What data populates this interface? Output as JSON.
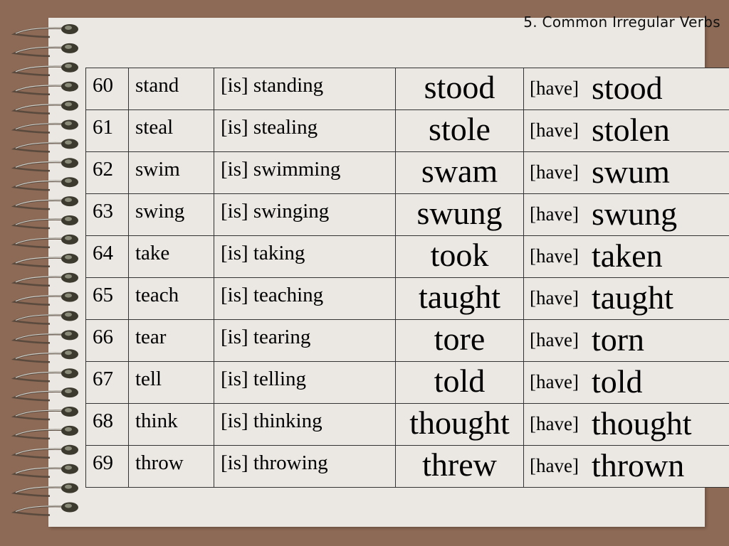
{
  "title": "5.  Common Irregular Verbs",
  "have_label": "[have]",
  "colors": {
    "background": "#8d6a56",
    "paper": "#ebe8e3",
    "border": "#333333"
  },
  "rows": [
    {
      "num": "60",
      "base": "stand",
      "ing": "[is] standing",
      "past": "stood",
      "pp": "stood"
    },
    {
      "num": "61",
      "base": "steal",
      "ing": "[is] stealing",
      "past": "stole",
      "pp": "stolen"
    },
    {
      "num": "62",
      "base": "swim",
      "ing": "[is] swimming",
      "past": "swam",
      "pp": "swum"
    },
    {
      "num": "63",
      "base": "swing",
      "ing": "[is] swinging",
      "past": "swung",
      "pp": "swung"
    },
    {
      "num": "64",
      "base": "take",
      "ing": "[is] taking",
      "past": "took",
      "pp": "taken"
    },
    {
      "num": "65",
      "base": "teach",
      "ing": "[is] teaching",
      "past": "taught",
      "pp": "taught"
    },
    {
      "num": "66",
      "base": "tear",
      "ing": "[is] tearing",
      "past": "tore",
      "pp": "torn"
    },
    {
      "num": "67",
      "base": "tell",
      "ing": "[is] telling",
      "past": "told",
      "pp": "told"
    },
    {
      "num": "68",
      "base": "think",
      "ing": "[is] thinking",
      "past": "thought",
      "pp": "thought"
    },
    {
      "num": "69",
      "base": "throw",
      "ing": "[is] throwing",
      "past": "threw",
      "pp": "thrown"
    }
  ]
}
